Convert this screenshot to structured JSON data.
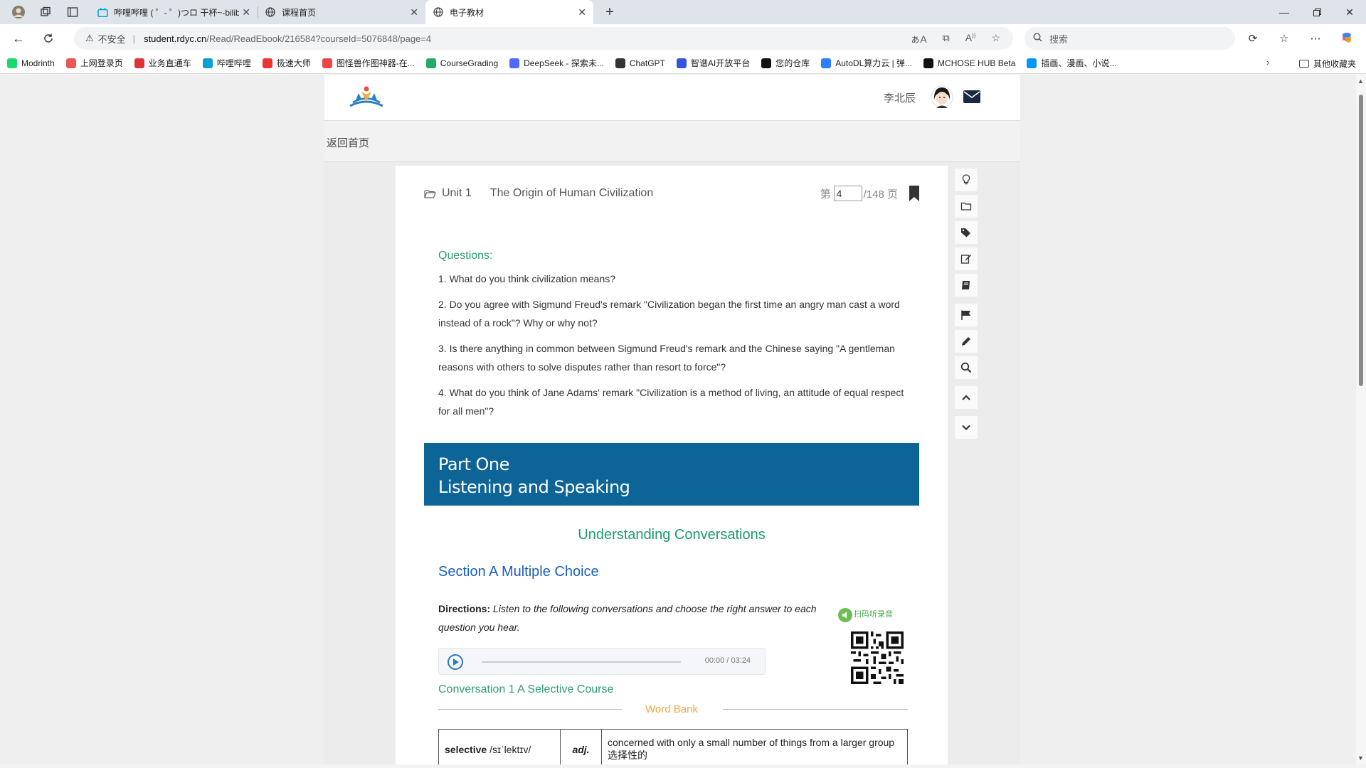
{
  "browser": {
    "tabs": [
      {
        "title": "哔哩哔哩 ( ゜- ゜)つロ 干杯~-bilibi...",
        "icon": "bilibili-icon",
        "active": false
      },
      {
        "title": "课程首页",
        "icon": "globe-icon",
        "active": false
      },
      {
        "title": "电子教材",
        "icon": "globe-icon",
        "active": true
      }
    ],
    "address": {
      "security_label": "不安全",
      "host": "student.rdyc.cn",
      "path": "/Read/ReadEbook/216584?courseId=5076848/page=4"
    },
    "search_placeholder": "搜索",
    "bookmarks": [
      {
        "label": "Modrinth",
        "color": "#1bd96a"
      },
      {
        "label": "上网登录页",
        "color": "#e55"
      },
      {
        "label": "业务直通车",
        "color": "#d33"
      },
      {
        "label": "哔哩哔哩",
        "color": "#00a1d6"
      },
      {
        "label": "极速大师",
        "color": "#e33"
      },
      {
        "label": "图怪兽作图神器-在...",
        "color": "#e44"
      },
      {
        "label": "CourseGrading",
        "color": "#2a6"
      },
      {
        "label": "DeepSeek - 探索未...",
        "color": "#4d6bfe"
      },
      {
        "label": "ChatGPT",
        "color": "#333"
      },
      {
        "label": "智谱AI开放平台",
        "color": "#3355dd"
      },
      {
        "label": "您的仓库",
        "color": "#111"
      },
      {
        "label": "AutoDL算力云 | 弹...",
        "color": "#2a7fff"
      },
      {
        "label": "MCHOSE HUB Beta",
        "color": "#111"
      },
      {
        "label": "插画、漫画、小说...",
        "color": "#0096fa"
      }
    ],
    "other_bookmarks": "其他收藏夹"
  },
  "site": {
    "user_name": "李北辰",
    "back_label": "返回首页"
  },
  "reader": {
    "unit_label": "Unit 1",
    "unit_title": "The Origin of Human Civilization",
    "page_prefix": "第",
    "page_value": "4",
    "page_suffix": "/148 页",
    "questions_title": "Questions:",
    "questions": [
      "1. What do you think civilization means?",
      "2. Do you agree with Sigmund Freud's remark \"Civilization began the first time an angry man cast a word instead of a rock\"? Why or why not?",
      "3. Is there anything in common between Sigmund Freud's remark and the Chinese saying \"A gentleman reasons with others to solve disputes rather than resort to force\"?",
      "4. What do you think of Jane Adams' remark \"Civilization is a method of living, an attitude of equal respect for all men\"?"
    ],
    "part_line1": "Part One",
    "part_line2": "Listening and Speaking",
    "sub_heading": "Understanding Conversations",
    "section_heading": "Section A Multiple Choice",
    "directions_label": "Directions:",
    "directions_text": "Listen to the following conversations and choose the right answer to each question you hear.",
    "scan_label": "扫码听录音",
    "audio_time": "00:00 / 03:24",
    "conversation_heading": "Conversation 1 A Selective Course",
    "word_bank_title": "Word Bank",
    "word_bank": [
      {
        "word": "selective",
        "phonetic": "/sɪˈlektɪv/",
        "pos": "adj.",
        "definition": "concerned with only a small number of things from a larger group 选择性的"
      }
    ]
  },
  "colors": {
    "banner": "#0d6497",
    "green_heading": "#2e9d76",
    "blue_heading": "#1a5fbf",
    "word_bank": "#f0a640"
  }
}
